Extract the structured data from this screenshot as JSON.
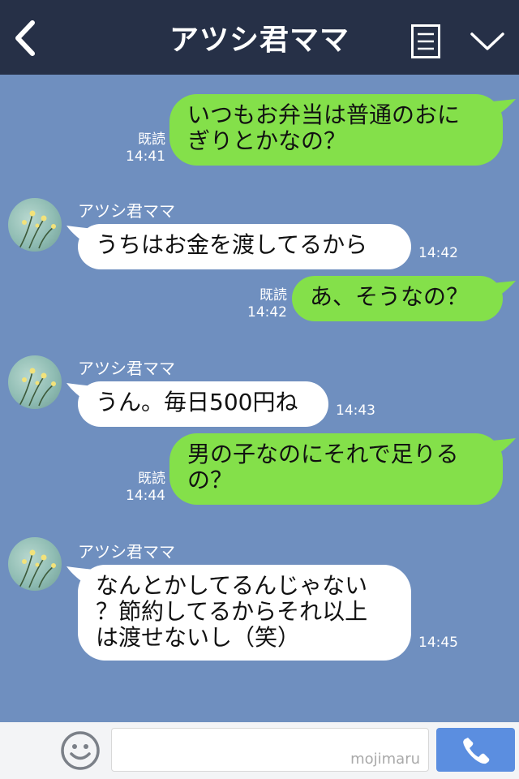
{
  "header": {
    "title": "アツシ君ママ"
  },
  "messages": [
    {
      "side": "right",
      "text_lines": [
        "いつもお弁当は普通のおに",
        "ぎりとかなの？"
      ],
      "read_label": "既読",
      "time": "14:41"
    },
    {
      "side": "left",
      "sender": "アツシ君ママ",
      "text_lines": [
        "うちはお金を渡してるから"
      ],
      "time": "14:42"
    },
    {
      "side": "right",
      "text_lines": [
        "あ、そうなの？"
      ],
      "read_label": "既読",
      "time": "14:42"
    },
    {
      "side": "left",
      "sender": "アツシ君ママ",
      "text_lines": [
        "うん。毎日500円ね"
      ],
      "time": "14:43"
    },
    {
      "side": "right",
      "text_lines": [
        "男の子なのにそれで足りる",
        "の？"
      ],
      "read_label": "既読",
      "time": "14:44"
    },
    {
      "side": "left",
      "sender": "アツシ君ママ",
      "text_lines": [
        "なんとかしてるんじゃない",
        "？節約してるからそれ以上",
        "は渡せないし（笑）"
      ],
      "time": "14:45"
    }
  ],
  "footer": {
    "watermark": "mojimaru"
  },
  "colors": {
    "header_bg": "#263047",
    "chat_bg": "#6f8fbf",
    "sent_bubble": "#84e04a",
    "received_bubble": "#ffffff",
    "call_button": "#5b8ee0"
  },
  "icons": [
    "back-arrow-icon",
    "menu-icon",
    "chevron-down-icon",
    "plus-icon",
    "smiley-icon",
    "phone-icon"
  ]
}
